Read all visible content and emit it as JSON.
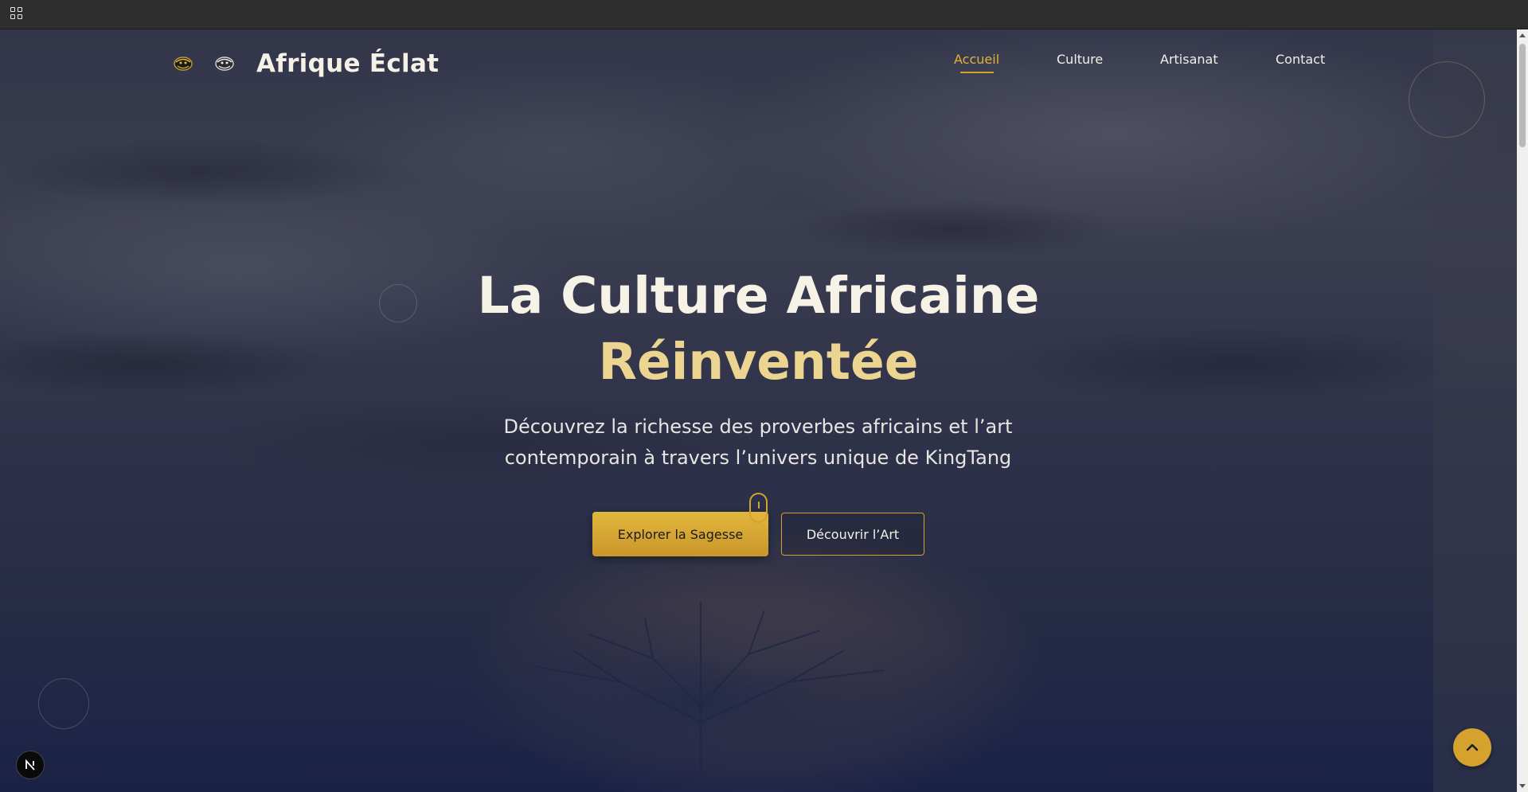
{
  "browser": {
    "apps_icon": "apps-grid-icon"
  },
  "header": {
    "brand": "Afrique Éclat",
    "nav": [
      {
        "label": "Accueil",
        "active": true
      },
      {
        "label": "Culture",
        "active": false
      },
      {
        "label": "Artisanat",
        "active": false
      },
      {
        "label": "Contact",
        "active": false
      }
    ]
  },
  "hero": {
    "title_line1": "La Culture Africaine",
    "title_line2": "Réinventée",
    "subtitle_line1": "Découvrez la richesse des proverbes africains et l’art",
    "subtitle_line2": "contemporain à travers l’univers unique de KingTang",
    "primary_button": "Explorer la Sagesse",
    "secondary_button": "Découvrir l’Art"
  },
  "widgets": {
    "back_to_top_icon": "chevron-up-icon",
    "dev_badge_icon": "nextjs-logo-icon"
  },
  "colors": {
    "accent": "#d4a22d",
    "title": "#f6f2e6",
    "title_highlight": "#ecd491"
  }
}
